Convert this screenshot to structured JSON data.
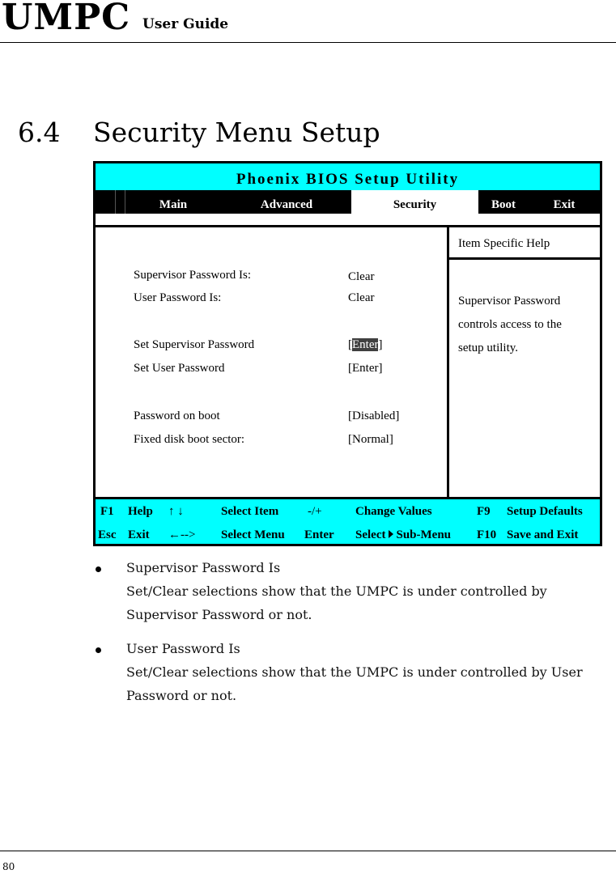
{
  "header": {
    "brand": "UMPC",
    "subtitle": "User Guide"
  },
  "section": {
    "number": "6.4",
    "title": "Security Menu Setup"
  },
  "bios": {
    "title": "Phoenix BIOS Setup Utility",
    "tabs": [
      {
        "label": "Main",
        "active": false
      },
      {
        "label": "Advanced",
        "active": false
      },
      {
        "label": "Security",
        "active": true
      },
      {
        "label": "Boot",
        "active": false
      },
      {
        "label": "Exit",
        "active": false
      }
    ],
    "items": [
      {
        "label": "Supervisor Password Is:",
        "value": "Clear"
      },
      {
        "label": "User Password Is:",
        "value": "Clear"
      },
      {
        "label": "Set Supervisor Password",
        "value_open": "[",
        "value_highlight": "Enter",
        "value_close": "]"
      },
      {
        "label": "Set User Password",
        "value": "[Enter]"
      },
      {
        "label": "Password on boot",
        "value": "[Disabled]"
      },
      {
        "label": "Fixed disk boot sector:",
        "value": "[Normal]"
      }
    ],
    "help": {
      "heading": "Item Specific Help",
      "lines": [
        "Supervisor Password",
        "controls access to the",
        "setup utility."
      ]
    },
    "footer": {
      "row1": [
        {
          "key": "F1",
          "action": "Help"
        },
        {
          "key": "↑ ↓",
          "action": "Select Item"
        },
        {
          "key": "-/+",
          "action": "Change Values"
        },
        {
          "key": "F9",
          "action": "Setup Defaults"
        }
      ],
      "row2": [
        {
          "key": "Esc",
          "action": "Exit"
        },
        {
          "key": "←-->",
          "action": "Select Menu"
        },
        {
          "key": "Enter",
          "action_pre": "Select",
          "action_post": "Sub-Menu"
        },
        {
          "key": "F10",
          "action": "Save and Exit"
        }
      ]
    }
  },
  "bullets": [
    {
      "title": "Supervisor Password Is",
      "lines": [
        "Set/Clear selections show that the UMPC is under controlled by",
        "Supervisor Password or not."
      ]
    },
    {
      "title": "User Password Is",
      "lines": [
        "Set/Clear selections show that the UMPC is under controlled by User",
        "Password or not."
      ]
    }
  ],
  "page_number": "80"
}
